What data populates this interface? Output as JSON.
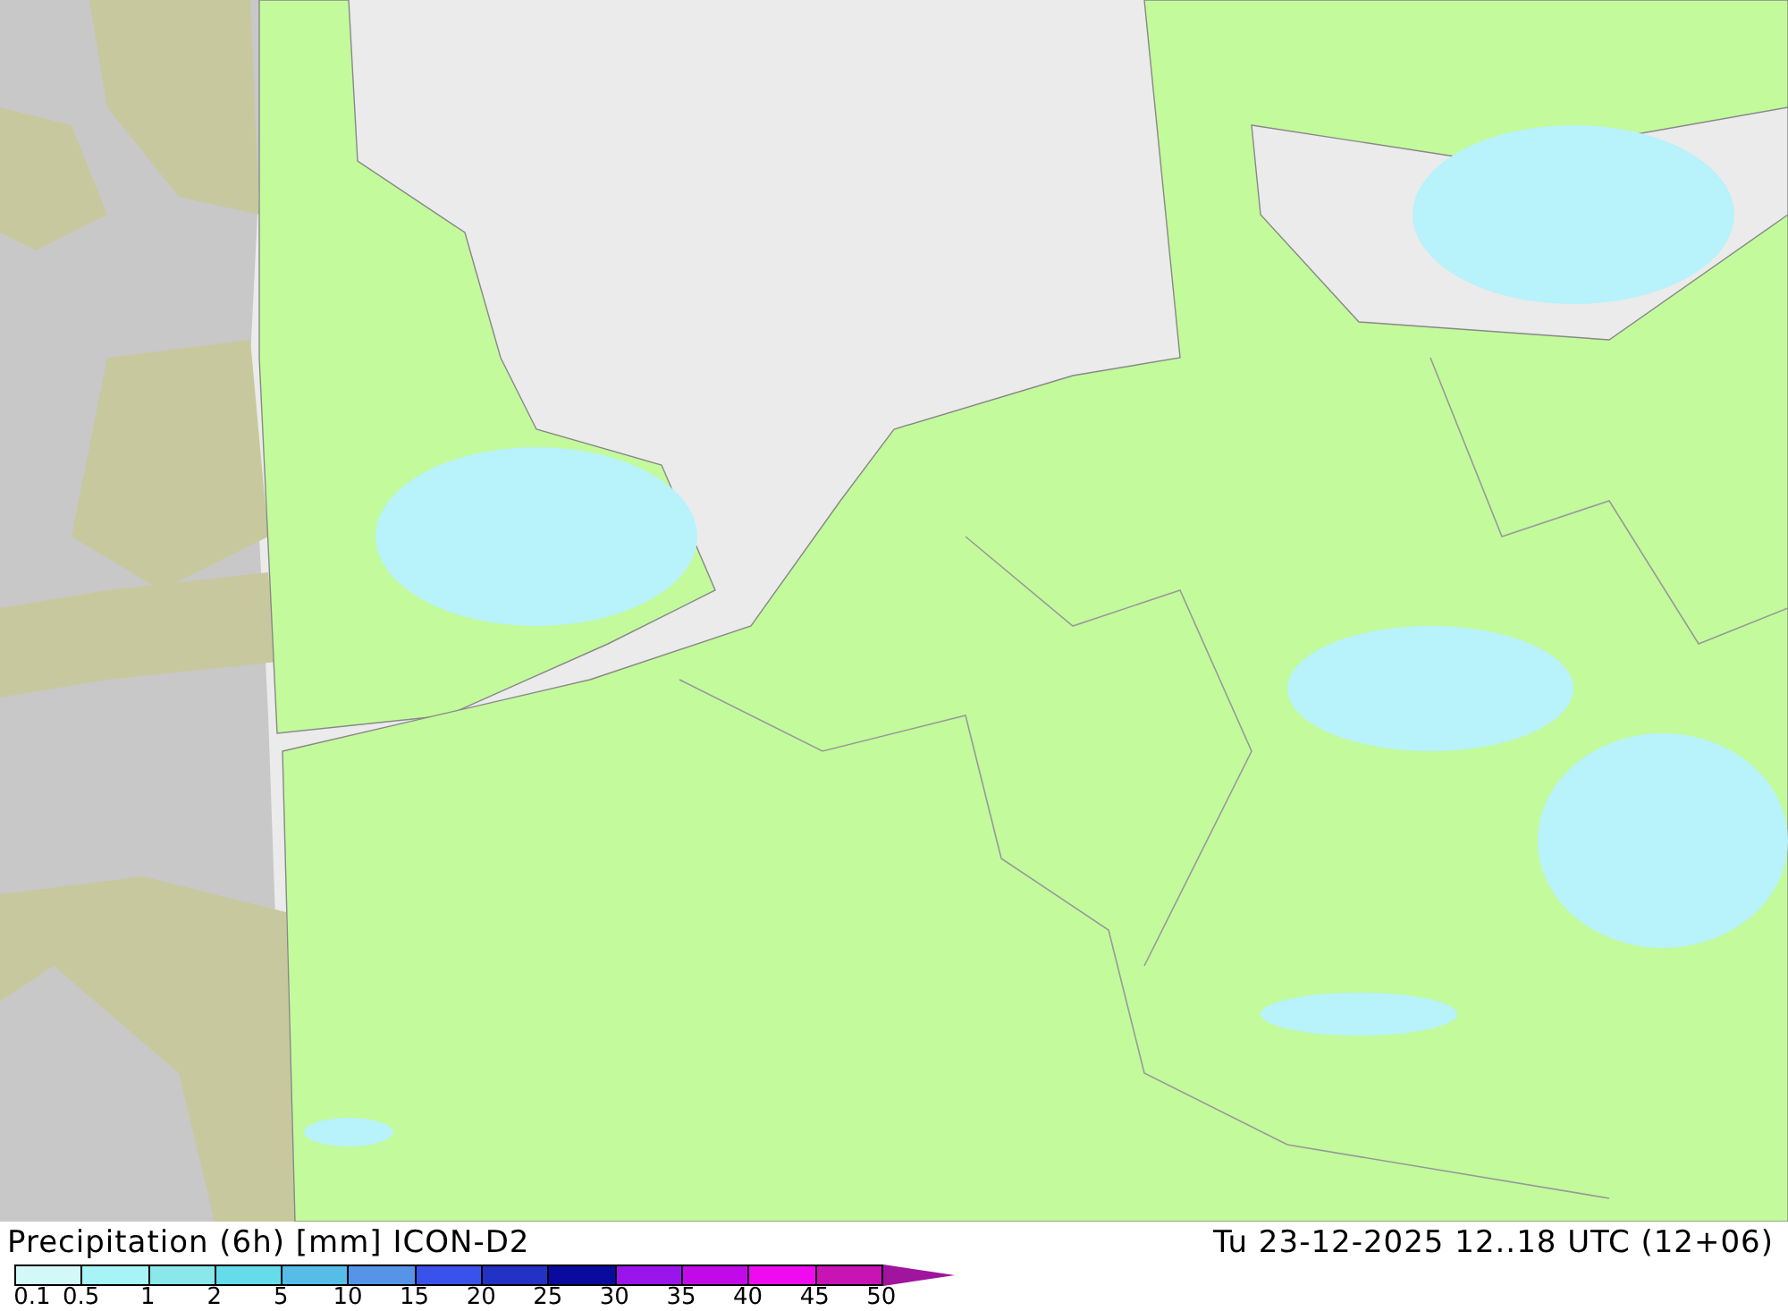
{
  "title": "Precipitation (6h) [mm] ICON-D2",
  "valid_time": "Tu 23-12-2025 12..18 UTC (12+06)",
  "legend": {
    "segments": [
      {
        "color": "#d2f8f8"
      },
      {
        "color": "#a6f4f6"
      },
      {
        "color": "#8ae8ea"
      },
      {
        "color": "#64dcec"
      },
      {
        "color": "#56bce8"
      },
      {
        "color": "#5694e8"
      },
      {
        "color": "#3a52ec"
      },
      {
        "color": "#2232c4"
      },
      {
        "color": "#0a0a9e"
      },
      {
        "color": "#9a14ec"
      },
      {
        "color": "#c20ae8"
      },
      {
        "color": "#f00af0"
      },
      {
        "color": "#c814b4"
      }
    ],
    "ticks": [
      "0.1",
      "0.5",
      "1",
      "2",
      "5",
      "10",
      "15",
      "20",
      "25",
      "30",
      "35",
      "40",
      "45",
      "50"
    ]
  }
}
